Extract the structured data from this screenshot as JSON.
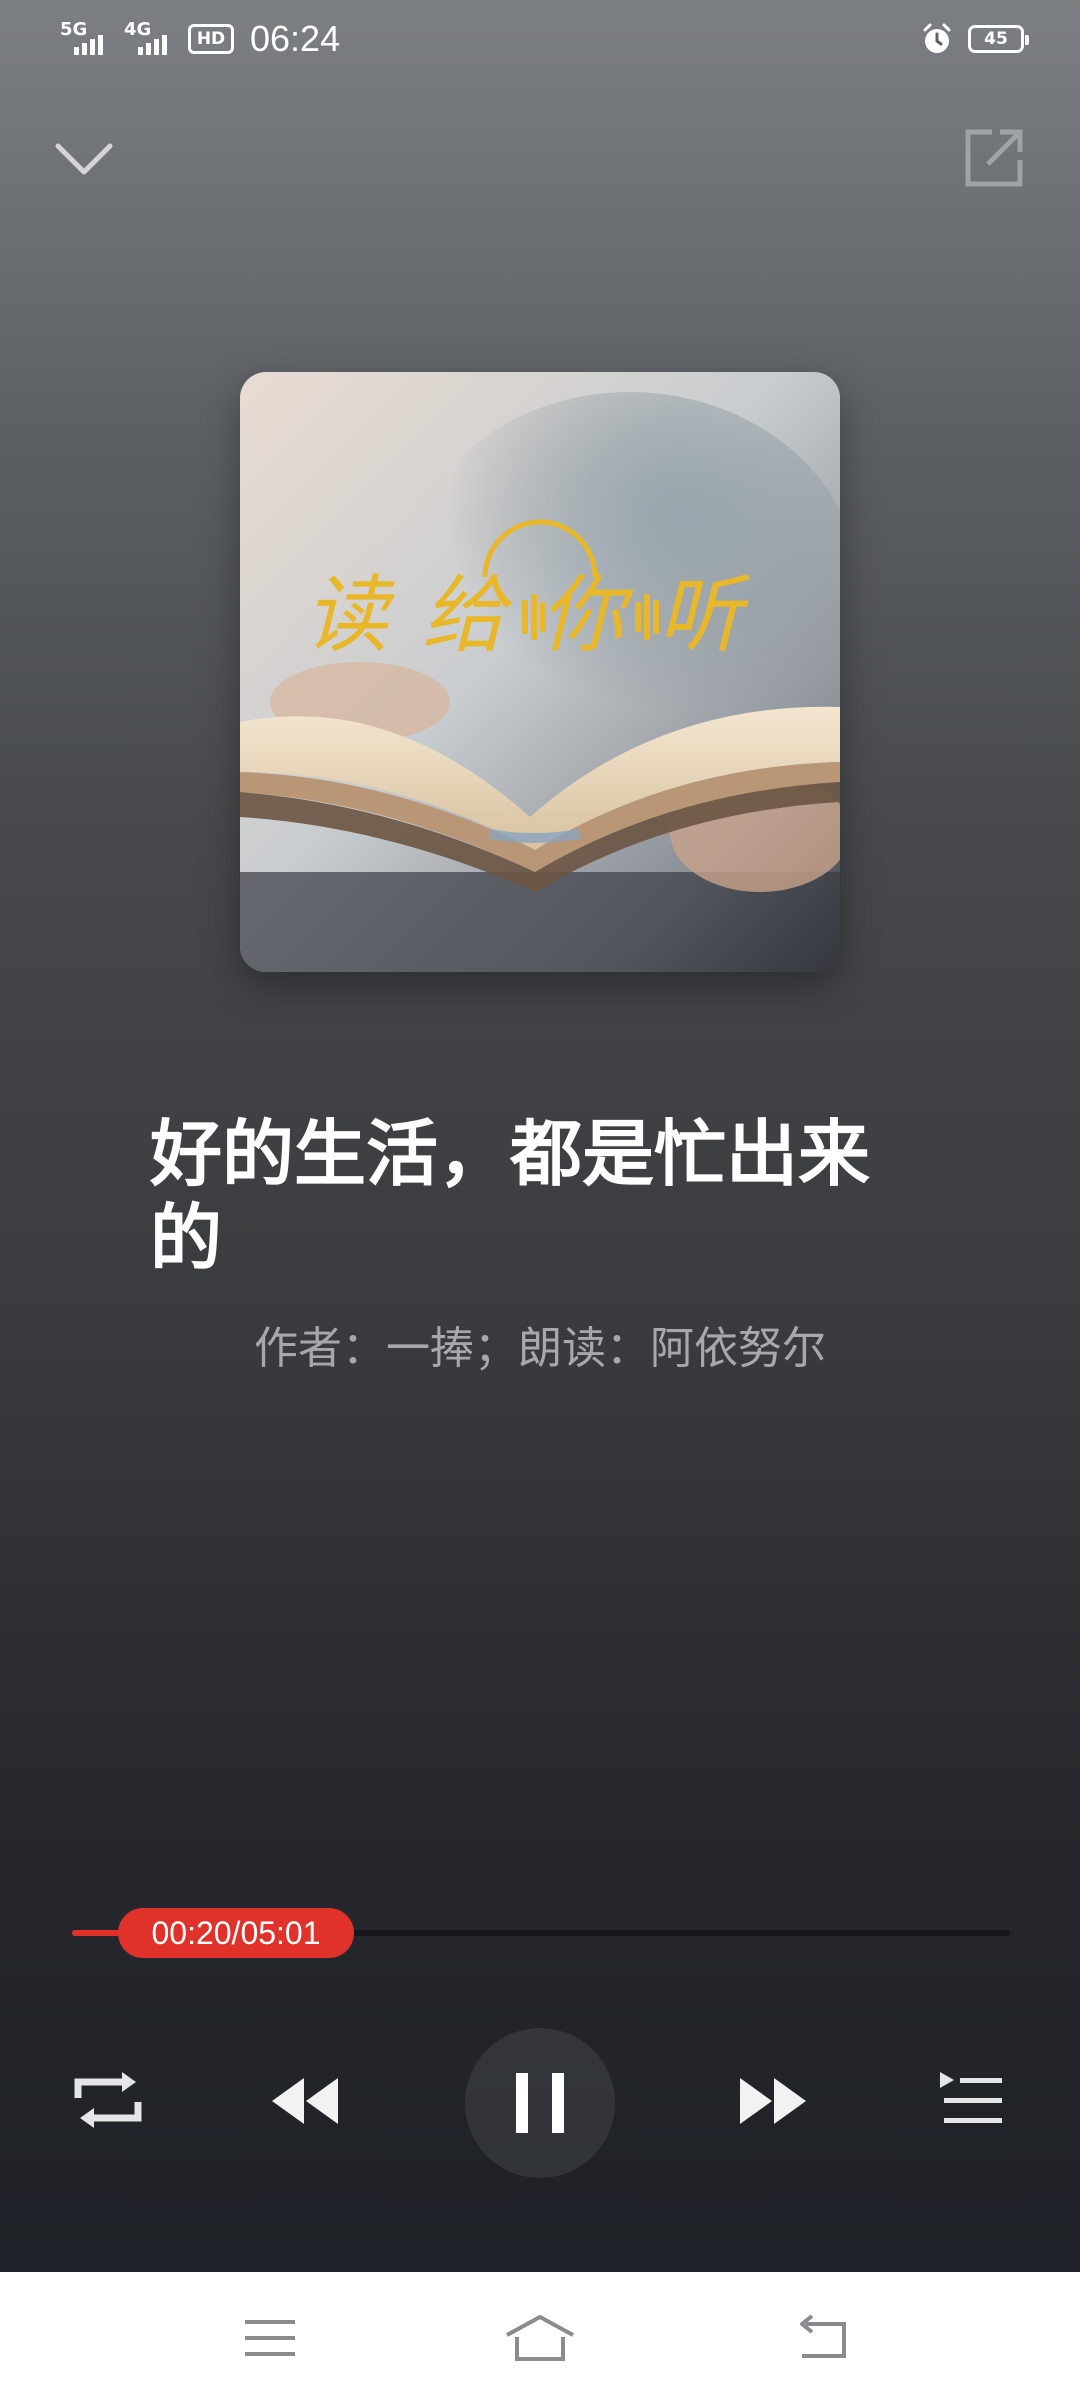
{
  "status_bar": {
    "network_1": "5G",
    "network_2": "4G",
    "hd_label": "HD",
    "time": "06:24",
    "battery": "45"
  },
  "icons": {
    "collapse": "chevron-down-icon",
    "share": "share-out-icon",
    "repeat": "repeat-icon",
    "rewind": "rewind-icon",
    "pause": "pause-icon",
    "forward": "fast-forward-icon",
    "playlist": "playlist-icon",
    "menu": "menu-icon",
    "home": "home-icon",
    "back": "back-icon",
    "alarm": "alarm-icon"
  },
  "cover": {
    "logo_text": "读给你听"
  },
  "track": {
    "title": "好的生活，都是忙出来的",
    "subtitle": "作者：一捧；朗读：阿依努尔"
  },
  "progress": {
    "time_label": "00:20/05:01",
    "fraction": 0.066
  },
  "colors": {
    "accent": "#e0322b",
    "logo_gold": "#e8b82a"
  }
}
